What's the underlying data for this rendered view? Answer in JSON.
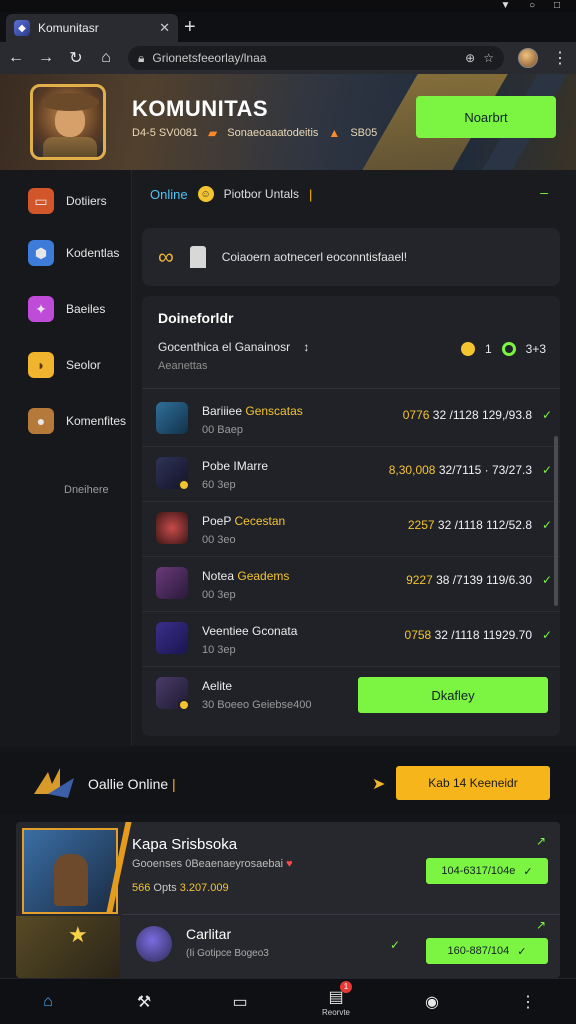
{
  "browser": {
    "tab_title": "Komunitasr",
    "url": "Grionetsfeeorlay/lnaa",
    "status_icons": "▼ ○ □"
  },
  "hero": {
    "title": "KOMUNITAS",
    "meta_1": "D4-5 SV0081",
    "meta_2": "Sonaeoaaatodeitis",
    "meta_3": "SB05",
    "button": "Noarbrt"
  },
  "sidebar": {
    "items": [
      {
        "label": "Dotiiers",
        "icon": "chest-icon",
        "color": "#d3562a"
      },
      {
        "label": "Kodentlas",
        "icon": "shield-icon",
        "color": "#3d7bd8"
      },
      {
        "label": "Baeiles",
        "icon": "crystal-icon",
        "color": "#c04bd8"
      },
      {
        "label": "Seolor",
        "icon": "lemon-icon",
        "color": "#f1b42f"
      },
      {
        "label": "Komenfites",
        "icon": "monkey-icon",
        "color": "#b57a3a"
      }
    ],
    "extra": "Dneihere"
  },
  "main": {
    "tab_online": "Online",
    "tab_post": "Piotbor Untals",
    "banner_text": "Coiaoern aotnecerl eoconntisfaael!",
    "panel": {
      "title": "Doineforldr",
      "subtitle": "Gocenthica el Ganainosr",
      "subtitle_mark": "↕",
      "caption": "Aeanettas",
      "stat_coin": "1",
      "stat_eye": "3+3"
    },
    "rows": [
      {
        "name": "Bariiiee",
        "name_hl": "Genscatas",
        "sub": "00 Baep",
        "val_hl": "0776",
        "val": "32 /1128 129,/93.8",
        "color": "#2f6f9a"
      },
      {
        "name": "Pobe IMarre",
        "name_hl": "",
        "sub": "60 3ep",
        "val_hl": "8,30,008",
        "val": "32/7115 · 73/27.3",
        "color": "#2f3356"
      },
      {
        "name": "PoeP",
        "name_hl": "Cecestan",
        "sub": "00 3eo",
        "val_hl": "2257",
        "val": "32 /1118 112/52.8",
        "color": "#6b2b2b"
      },
      {
        "name": "Notea",
        "name_hl": "Geadems",
        "sub": "00 3ep",
        "val_hl": "9227",
        "val": "38 /7139 119/6.30",
        "color": "#6a3a7a"
      },
      {
        "name": "Veentiee Gconata",
        "name_hl": "",
        "sub": "10 3ep",
        "val_hl": "0758",
        "val": "32 /1118 11929.70",
        "color": "#3a2f8a"
      },
      {
        "name": "Aelite",
        "name_hl": "",
        "sub": "30 Boeeo Geiebse400",
        "button": "Dkafley",
        "color": "#4a3c6a"
      }
    ]
  },
  "lower": {
    "title": "Oallie Online",
    "button": "Kab 14 Keeneidr"
  },
  "cards": {
    "card1": {
      "title": "Kapa Srisbsoka",
      "sub": "Gooenses 0Beaenaeyrosaebai",
      "meta_prefix": "566",
      "meta_text": "Opts",
      "meta_hl": "3.207.009",
      "button": "104-6317/104e"
    },
    "card2": {
      "title": "Carlitar",
      "sub": "(Ii Gotipce Bogeo3",
      "button": "160-887/104"
    }
  },
  "bottomnav": {
    "items": [
      {
        "icon": "home-icon",
        "glyph": "⌂"
      },
      {
        "icon": "tools-icon",
        "glyph": "⚒"
      },
      {
        "icon": "tablet-icon",
        "glyph": "▭"
      },
      {
        "icon": "news-icon",
        "glyph": "▤",
        "label": "Reorvte",
        "badge": "1"
      },
      {
        "icon": "compass-icon",
        "glyph": "◉"
      },
      {
        "icon": "more-icon",
        "glyph": "⋮"
      }
    ]
  }
}
